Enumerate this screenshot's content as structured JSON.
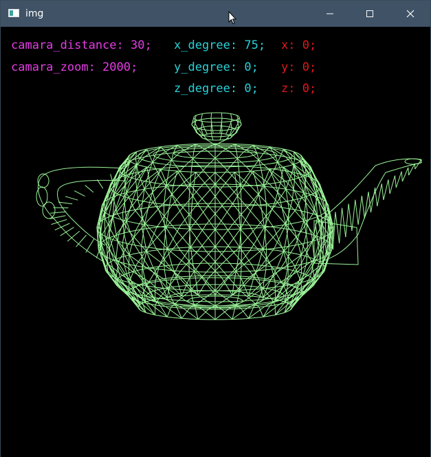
{
  "window": {
    "title": "img",
    "icon": "app-window-icon",
    "controls": [
      "minimize-icon",
      "maximize-icon",
      "close-icon"
    ]
  },
  "hud": {
    "camara_distance": "camara_distance: 30;",
    "camara_zoom": "camara_zoom: 2000;",
    "x_degree": "x_degree: 75;",
    "y_degree": "y_degree: 0;",
    "z_degree": "z_degree: 0;",
    "x": "x: 0;",
    "y": "y: 0;",
    "z": "z: 0;"
  },
  "colors": {
    "wireframe": "#9cf59a",
    "camera_text": "#e63ce6",
    "degree_text": "#28d2d8",
    "position_text": "#e0191e",
    "titlebar": "#3f5266",
    "background": "#000000"
  }
}
